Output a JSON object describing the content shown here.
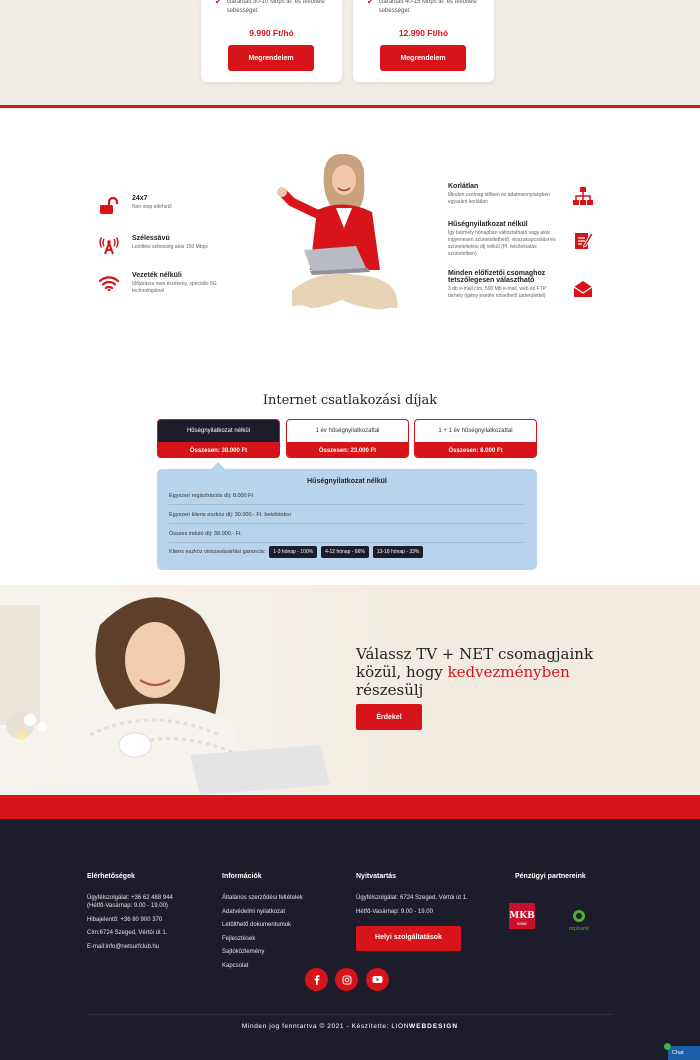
{
  "pricing": {
    "cards": [
      {
        "feature": "Garantált 30-10 Mbps le- és feltöltési sebességet",
        "price": "9.990 Ft/hó",
        "button": "Megrendelem"
      },
      {
        "feature": "Garantált 40-15 Mbps le- és feltöltési sebességet",
        "price": "12.990 Ft/hó",
        "button": "Megrendelem"
      }
    ]
  },
  "features_left": [
    {
      "icon": "unlock-icon",
      "title": "24x7",
      "desc": "Non-stop elérhető"
    },
    {
      "icon": "antenna-icon",
      "title": "Szélessávú",
      "desc": "Letöltési sebesség akár 150 Mbps"
    },
    {
      "icon": "wifi-icon",
      "title": "Vezeték nélküli",
      "desc": "Időjárásra nem érzékeny, speciális 5G technológiával"
    }
  ],
  "features_right": [
    {
      "icon": "network-icon",
      "title": "Korlátlan",
      "desc": "Minden csomag időben és adatmennyiségben egyaránt korlátlan"
    },
    {
      "icon": "contract-icon",
      "title": "Hűségnyilatkozat nélkül",
      "desc": "Így bármely hónapban változtatható vagy akár ingyenesen szüneteltethető, visszakapcsolási és szüneteltetési díj nélkül (Pl. felsőoktatás szünetelben)"
    },
    {
      "icon": "mail-icon",
      "title": "Minden előfizetői csomaghoz tetszőlegesen választható",
      "desc": "3 db e-mail cím, 500 Mb e-mail, web és FTP tárhely (igény esetén növelhető tárterülettel)"
    }
  ],
  "fees": {
    "title": "Internet csatlakozási díjak",
    "tabs": [
      {
        "label": "Hűségnyilatkozat nélkül",
        "total": "Összesen: 38.000 Ft"
      },
      {
        "label": "1 év hűségnyilatkozattal",
        "total": "Összesen: 23.000 Ft"
      },
      {
        "label": "1 + 1 év hűségnyilatkozattal",
        "total": "Összesen: 8.000 Ft"
      }
    ],
    "panel_title": "Hűségnyilatkozat nélkül",
    "rows": [
      "Egyszeri regisztrációs díj: 8.000 Ft",
      "Egyszeri kliens eszköz díj: 30.000.- Ft. bekötéskor",
      "Összes induló díj: 38.000.- Ft.",
      "Kliens eszköz visszavásárlási garancia:"
    ],
    "chips": [
      "1-3 hónap - 100%",
      "4-12 hónap - 66%",
      "13-18 hónap - 33%"
    ]
  },
  "promo": {
    "line1": "Válassz TV + NET csomagjaink",
    "line2a": "közül, hogy ",
    "line2b": "kedvezményben",
    "line3": "részesülj",
    "button": "Érdekel"
  },
  "footer": {
    "contacts": {
      "title": "Elérhetőségek",
      "lines": [
        "Ügyfélszolgálat: +36 62 488 944",
        "(Hétfő-Vasárnap: 9.00 - 19.00)",
        "Hibajelentő: +36 80 900 370",
        "Cím:6724 Szeged, Vértói út 1.",
        "E-mail:info@netsurfclub.hu"
      ]
    },
    "info": {
      "title": "Információk",
      "links": [
        "Általános szerződési feltételek",
        "Adatvédelmi nyilatkozat",
        "Letölthető dokumentumok",
        "Fejlesztések",
        "Sajtóközlemény",
        "Kapcsolat"
      ]
    },
    "hours": {
      "title": "Nyitvatartás",
      "lines": [
        "Ügyfélszolgálat: 6724 Szeged, Vértói út 1.",
        "Hétfő-Vasárnap: 9.00 - 19.00"
      ],
      "button": "Helyi szolgáltatások"
    },
    "partners": {
      "title": "Pénzügyi partnereink",
      "logos": [
        "MKB BANK",
        "otpbank"
      ]
    },
    "copyright": "Minden jog fenntartva © 2021 - Készítette: LION",
    "copyright_brand": "WEBDESIGN",
    "chat": "Chat"
  }
}
